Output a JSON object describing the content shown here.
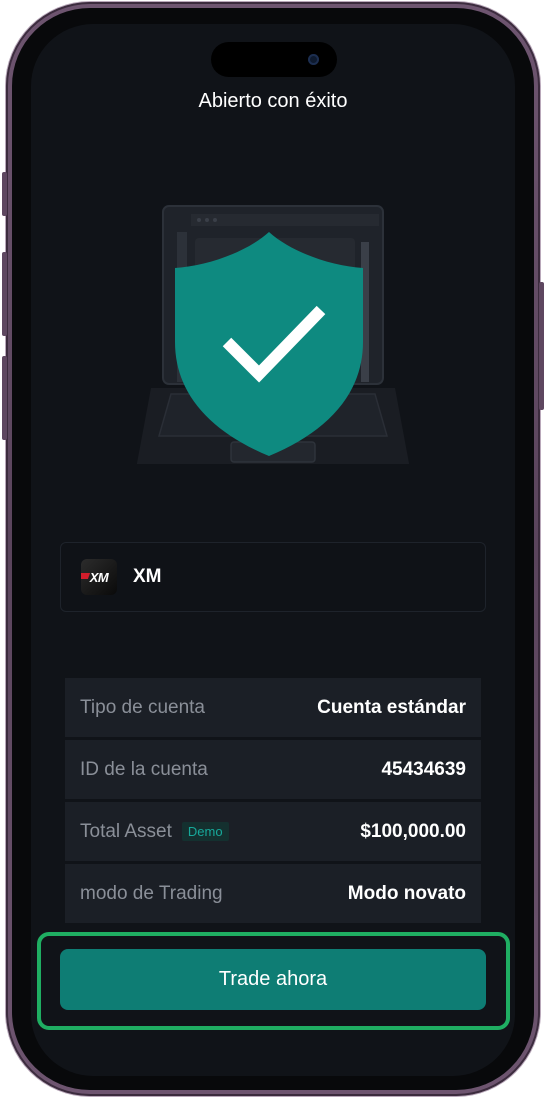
{
  "screen": {
    "title": "Abierto con éxito"
  },
  "illustration": {
    "icon": "shield-check-icon",
    "shield_color": "#0e8a80"
  },
  "broker": {
    "logo_text": "XM",
    "name": "XM"
  },
  "account_info": [
    {
      "label": "Tipo de cuenta",
      "value": "Cuenta estándar",
      "badge": null
    },
    {
      "label": "ID de la cuenta",
      "value": "45434639",
      "badge": null
    },
    {
      "label": "Total Asset",
      "value": "$100,000.00",
      "badge": "Demo"
    },
    {
      "label": "modo de Trading",
      "value": "Modo novato",
      "badge": null
    }
  ],
  "actions": {
    "trade_now_label": "Trade ahora"
  },
  "colors": {
    "background": "#101318",
    "accent": "#0e7d74",
    "highlight": "#1fae62",
    "row_bg": "#1b1f26",
    "badge_text": "#17a89a"
  }
}
